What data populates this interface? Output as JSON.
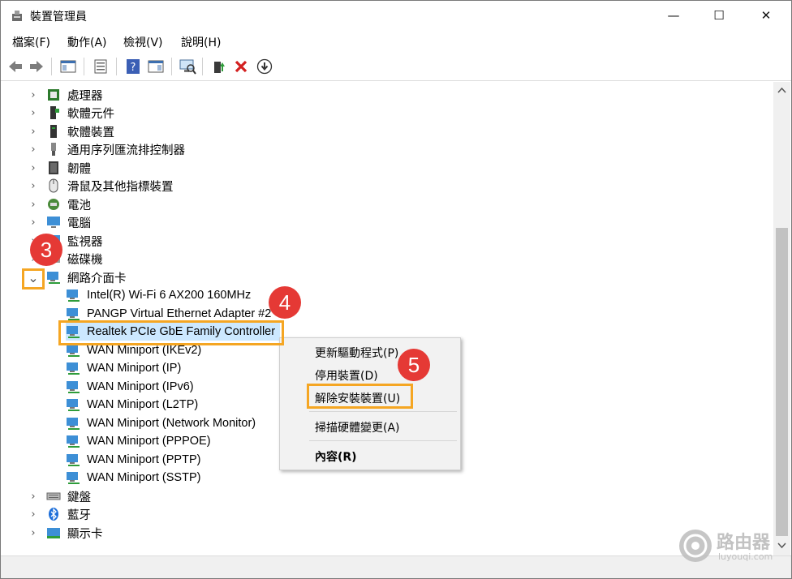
{
  "window": {
    "title": "裝置管理員",
    "minimize_glyph": "—",
    "maximize_glyph": "☐",
    "close_glyph": "✕"
  },
  "menu": [
    {
      "label": "檔案(F)"
    },
    {
      "label": "動作(A)"
    },
    {
      "label": "檢視(V)"
    },
    {
      "label": "說明(H)"
    }
  ],
  "toolbar": {
    "icons": [
      "back-arrow-icon",
      "forward-arrow-icon",
      "show-hide-console-tree-icon",
      "properties-icon",
      "help-icon",
      "action-pane-icon",
      "scan-hardware-icon",
      "update-driver-icon",
      "uninstall-icon",
      "download-icon"
    ]
  },
  "tree": {
    "categories": [
      {
        "label": "處理器",
        "icon": "processor-icon"
      },
      {
        "label": "軟體元件",
        "icon": "software-component-icon"
      },
      {
        "label": "軟體裝置",
        "icon": "software-device-icon"
      },
      {
        "label": "通用序列匯流排控制器",
        "icon": "usb-icon"
      },
      {
        "label": "韌體",
        "icon": "firmware-icon"
      },
      {
        "label": "滑鼠及其他指標裝置",
        "icon": "mouse-icon"
      },
      {
        "label": "電池",
        "icon": "battery-icon"
      },
      {
        "label": "電腦",
        "icon": "computer-icon"
      },
      {
        "label": "監視器",
        "icon": "monitor-icon"
      },
      {
        "label": "磁碟機",
        "icon": "disk-icon"
      },
      {
        "label": "網路介面卡",
        "icon": "network-adapter-icon"
      }
    ],
    "network_children": [
      {
        "label": "Intel(R) Wi-Fi 6 AX200 160MHz"
      },
      {
        "label": "PANGP Virtual Ethernet Adapter #2"
      },
      {
        "label": "Realtek PCIe GbE Family Controller"
      },
      {
        "label": "WAN Miniport (IKEv2)"
      },
      {
        "label": "WAN Miniport (IP)"
      },
      {
        "label": "WAN Miniport (IPv6)"
      },
      {
        "label": "WAN Miniport (L2TP)"
      },
      {
        "label": "WAN Miniport (Network Monitor)"
      },
      {
        "label": "WAN Miniport (PPPOE)"
      },
      {
        "label": "WAN Miniport (PPTP)"
      },
      {
        "label": "WAN Miniport (SSTP)"
      }
    ],
    "after": [
      {
        "label": "鍵盤",
        "icon": "keyboard-icon"
      },
      {
        "label": "藍牙",
        "icon": "bluetooth-icon"
      },
      {
        "label": "顯示卡",
        "icon": "display-adapter-icon"
      }
    ],
    "expand_glyph": "›",
    "expanded_glyph": "⌄"
  },
  "context_menu": {
    "items": [
      {
        "label": "更新驅動程式(P)"
      },
      {
        "label": "停用裝置(D)"
      },
      {
        "label": "解除安裝裝置(U)"
      },
      {
        "label": "掃描硬體變更(A)"
      },
      {
        "label": "內容(R)"
      }
    ]
  },
  "annotations": {
    "step3": "3",
    "step4": "4",
    "step5": "5"
  },
  "watermark": {
    "title": "路由器",
    "url": "luyouqi.com"
  },
  "colors": {
    "highlight_border": "#f5a623",
    "badge": "#e53935",
    "selection": "#cce8ff"
  }
}
